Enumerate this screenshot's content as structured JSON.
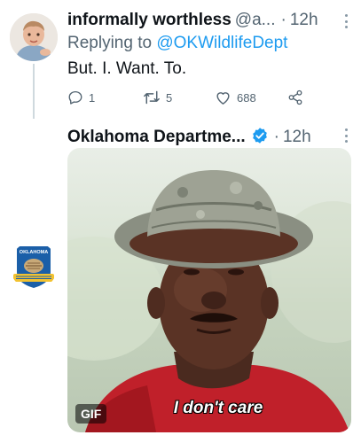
{
  "reply_tweet": {
    "display_name": "informally worthless",
    "handle": "@a...",
    "separator": "·",
    "time": "12h",
    "replying_prefix": "Replying to",
    "replying_to": "@OKWildlifeDept",
    "text": "But. I. Want. To.",
    "actions": {
      "reply_count": "1",
      "retweet_count": "5",
      "like_count": "688"
    }
  },
  "main_tweet": {
    "display_name": "Oklahoma Departme...",
    "separator": "·",
    "time": "12h",
    "verified": true,
    "avatar_text": "OKLAHOMA",
    "media": {
      "badge": "GIF",
      "caption": "I don't care"
    }
  },
  "colors": {
    "link": "#1d9bf0",
    "secondary_text": "#536471",
    "verified": "#1d9bf0"
  }
}
